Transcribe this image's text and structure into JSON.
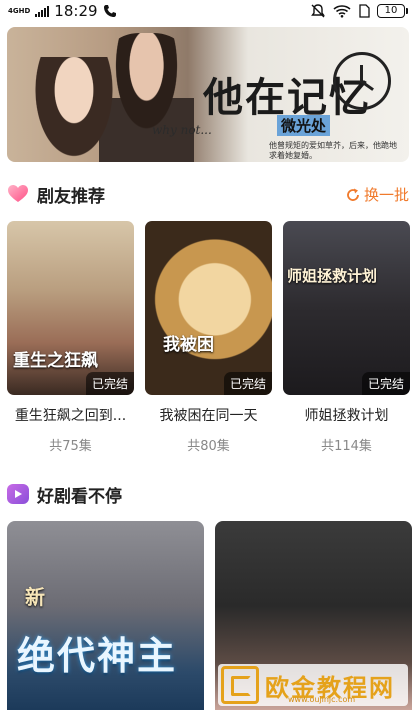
{
  "status_bar": {
    "network": "4GHD",
    "time": "18:29",
    "battery": "10"
  },
  "banner": {
    "title": "他在记忆",
    "subtitle": "微光处",
    "script_text": "why not...",
    "tagline": "他曾规矩的爱如草芥，后来，他跪地求着她复婚。"
  },
  "section_friends": {
    "title": "剧友推荐",
    "refresh_label": "换一批"
  },
  "cards": [
    {
      "name": "重生狂飙之回到...",
      "count": "共75集",
      "badge": "已完结",
      "poster_text": "重生之狂飙"
    },
    {
      "name": "我被困在同一天",
      "count": "共80集",
      "badge": "已完结",
      "poster_text": "我被困"
    },
    {
      "name": "师姐拯救计划",
      "count": "共114集",
      "badge": "已完结",
      "poster_text": "师姐拯救计划"
    }
  ],
  "section_binge": {
    "title": "好剧看不停"
  },
  "big_posters": [
    {
      "title": "绝代神主",
      "tag": "新"
    },
    {
      "title": ""
    }
  ],
  "watermark": {
    "text": "欧金教程网",
    "small": "www.oujinjc.com"
  },
  "colors": {
    "accent": "#f07a2c",
    "heart": "#ff5b8a"
  }
}
